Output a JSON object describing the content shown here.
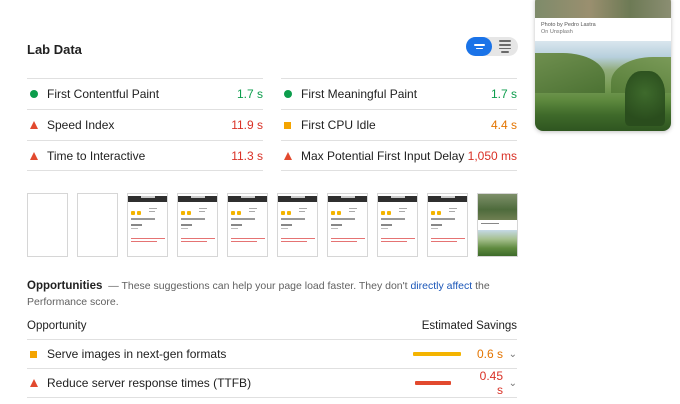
{
  "lab_data": {
    "title": "Lab Data"
  },
  "metrics": [
    {
      "label": "First Contentful Paint",
      "value": "1.7 s",
      "status": "pass",
      "color": "#0c9d4c"
    },
    {
      "label": "First Meaningful Paint",
      "value": "1.7 s",
      "status": "pass",
      "color": "#0c9d4c"
    },
    {
      "label": "Speed Index",
      "value": "11.9 s",
      "status": "fail",
      "color": "#d93025"
    },
    {
      "label": "First CPU Idle",
      "value": "4.4 s",
      "status": "average",
      "color": "#e37400"
    },
    {
      "label": "Time to Interactive",
      "value": "11.3 s",
      "status": "fail",
      "color": "#d93025"
    },
    {
      "label": "Max Potential First Input Delay",
      "value": "1,050 ms",
      "status": "fail",
      "color": "#d93025"
    }
  ],
  "opportunities": {
    "title": "Opportunities",
    "desc_before": "— These suggestions can help your page load faster. They don't",
    "link": "directly affect",
    "desc_after": "the Performance score.",
    "col_opportunity": "Opportunity",
    "col_savings": "Estimated Savings",
    "items": [
      {
        "label": "Serve images in next-gen formats",
        "value": "0.6 s",
        "status": "average",
        "color": "#e37400",
        "bar_color": "#f4b400"
      },
      {
        "label": "Reduce server response times (TTFB)",
        "value": "0.45 s",
        "status": "fail",
        "color": "#d93025",
        "bar_color": "#e2492e"
      }
    ]
  },
  "side_card": {
    "caption_line1": "Photo by Pedro Lastra",
    "caption_line2": "On Unsplash"
  },
  "colors": {
    "pass": "#0c9d4c",
    "average": "#e37400",
    "fail": "#d93025",
    "accent": "#1a73e8"
  },
  "icons": {
    "toggle_left": "bar-chart-icon",
    "toggle_right": "list-icon",
    "expand": "chevron-down-icon"
  }
}
